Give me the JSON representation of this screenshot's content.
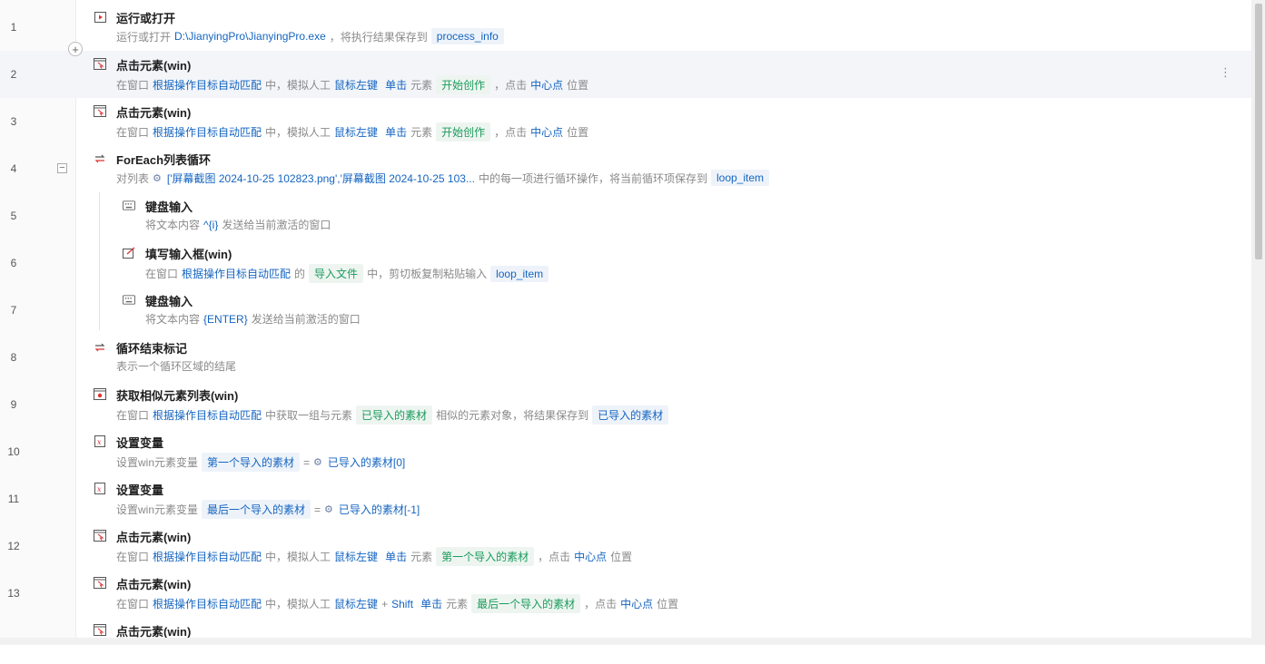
{
  "rows": [
    {
      "line": "1",
      "title": "运行或打开",
      "icon": "play-icon",
      "desc": [
        {
          "k": "t",
          "s": "运行或打开"
        },
        {
          "k": "v",
          "s": "D:\\JianyingPro\\JianyingPro.exe"
        },
        {
          "k": "t",
          "s": "，将执行结果保存到"
        },
        {
          "k": "tag",
          "s": "process_info"
        }
      ]
    },
    {
      "line": "2",
      "title": "点击元素(win)",
      "icon": "click-element-icon",
      "desc": [
        {
          "k": "t",
          "s": "在窗口"
        },
        {
          "k": "v",
          "s": "根据操作目标自动匹配"
        },
        {
          "k": "t",
          "s": "中，模拟人工"
        },
        {
          "k": "v",
          "s": "鼠标左键"
        },
        {
          "k": "v",
          "s": "单击"
        },
        {
          "k": "t",
          "s": "元素"
        },
        {
          "k": "tagg",
          "s": "开始创作"
        },
        {
          "k": "t",
          "s": "，点击"
        },
        {
          "k": "v",
          "s": "中心点"
        },
        {
          "k": "t",
          "s": "位置"
        }
      ]
    },
    {
      "line": "3",
      "title": "点击元素(win)",
      "icon": "click-element-icon",
      "desc": [
        {
          "k": "t",
          "s": "在窗口"
        },
        {
          "k": "v",
          "s": "根据操作目标自动匹配"
        },
        {
          "k": "t",
          "s": "中，模拟人工"
        },
        {
          "k": "v",
          "s": "鼠标左键"
        },
        {
          "k": "v",
          "s": "单击"
        },
        {
          "k": "t",
          "s": "元素"
        },
        {
          "k": "tagg",
          "s": "开始创作"
        },
        {
          "k": "t",
          "s": "，点击"
        },
        {
          "k": "v",
          "s": "中心点"
        },
        {
          "k": "t",
          "s": "位置"
        }
      ]
    },
    {
      "line": "4",
      "title": "ForEach列表循环",
      "icon": "loop-icon",
      "desc": [
        {
          "k": "t",
          "s": "对列表"
        },
        {
          "k": "sym",
          "s": "⚙"
        },
        {
          "k": "v",
          "s": "['屏幕截图 2024-10-25 102823.png','屏幕截图 2024-10-25 103..."
        },
        {
          "k": "t",
          "s": "中的每一项进行循环操作，将当前循环项保存到"
        },
        {
          "k": "tag",
          "s": "loop_item"
        }
      ]
    },
    {
      "line": "5",
      "title": "键盘输入",
      "icon": "keyboard-icon",
      "indent": true,
      "desc": [
        {
          "k": "t",
          "s": "将文本内容"
        },
        {
          "k": "v",
          "s": "^{i}"
        },
        {
          "k": "t",
          "s": "发送给当前激活的窗口"
        }
      ]
    },
    {
      "line": "6",
      "title": "填写输入框(win)",
      "icon": "input-box-icon",
      "indent": true,
      "desc": [
        {
          "k": "t",
          "s": "在窗口"
        },
        {
          "k": "v",
          "s": "根据操作目标自动匹配"
        },
        {
          "k": "t",
          "s": "的"
        },
        {
          "k": "tagg",
          "s": "导入文件"
        },
        {
          "k": "t",
          "s": "中，剪切板复制粘贴输入"
        },
        {
          "k": "tag",
          "s": "loop_item"
        }
      ]
    },
    {
      "line": "7",
      "title": "键盘输入",
      "icon": "keyboard-icon",
      "indent": true,
      "desc": [
        {
          "k": "t",
          "s": "将文本内容"
        },
        {
          "k": "v",
          "s": "{ENTER}"
        },
        {
          "k": "t",
          "s": "发送给当前激活的窗口"
        }
      ]
    },
    {
      "line": "8",
      "title": "循环结束标记",
      "icon": "loop-end-icon",
      "desc": [
        {
          "k": "t",
          "s": "表示一个循环区域的结尾"
        }
      ]
    },
    {
      "line": "9",
      "title": "获取相似元素列表(win)",
      "icon": "similar-elements-icon",
      "desc": [
        {
          "k": "t",
          "s": "在窗口"
        },
        {
          "k": "v",
          "s": "根据操作目标自动匹配"
        },
        {
          "k": "t",
          "s": "中获取一组与元素"
        },
        {
          "k": "tagg",
          "s": "已导入的素材"
        },
        {
          "k": "t",
          "s": "相似的元素对象，将结果保存到"
        },
        {
          "k": "tag",
          "s": "已导入的素材"
        }
      ]
    },
    {
      "line": "10",
      "title": "设置变量",
      "icon": "variable-icon",
      "desc": [
        {
          "k": "t",
          "s": "设置win元素变量"
        },
        {
          "k": "tag",
          "s": "第一个导入的素材"
        },
        {
          "k": "t",
          "s": "="
        },
        {
          "k": "sym",
          "s": "⚙"
        },
        {
          "k": "v",
          "s": "已导入的素材[0]"
        }
      ]
    },
    {
      "line": "11",
      "title": "设置变量",
      "icon": "variable-icon",
      "desc": [
        {
          "k": "t",
          "s": "设置win元素变量"
        },
        {
          "k": "tag",
          "s": "最后一个导入的素材"
        },
        {
          "k": "t",
          "s": "="
        },
        {
          "k": "sym",
          "s": "⚙"
        },
        {
          "k": "v",
          "s": "已导入的素材[-1]"
        }
      ]
    },
    {
      "line": "12",
      "title": "点击元素(win)",
      "icon": "click-element-icon",
      "desc": [
        {
          "k": "t",
          "s": "在窗口"
        },
        {
          "k": "v",
          "s": "根据操作目标自动匹配"
        },
        {
          "k": "t",
          "s": "中，模拟人工"
        },
        {
          "k": "v",
          "s": "鼠标左键"
        },
        {
          "k": "v",
          "s": "单击"
        },
        {
          "k": "t",
          "s": "元素"
        },
        {
          "k": "tagg",
          "s": "第一个导入的素材"
        },
        {
          "k": "t",
          "s": "，点击"
        },
        {
          "k": "v",
          "s": "中心点"
        },
        {
          "k": "t",
          "s": "位置"
        }
      ]
    },
    {
      "line": "13",
      "title": "点击元素(win)",
      "icon": "click-element-icon",
      "desc": [
        {
          "k": "t",
          "s": "在窗口"
        },
        {
          "k": "v",
          "s": "根据操作目标自动匹配"
        },
        {
          "k": "t",
          "s": "中，模拟人工"
        },
        {
          "k": "v",
          "s": "鼠标左键"
        },
        {
          "k": "t",
          "s": "+"
        },
        {
          "k": "v",
          "s": "Shift"
        },
        {
          "k": "v",
          "s": "单击"
        },
        {
          "k": "t",
          "s": "元素"
        },
        {
          "k": "tagg",
          "s": "最后一个导入的素材"
        },
        {
          "k": "t",
          "s": "，点击"
        },
        {
          "k": "v",
          "s": "中心点"
        },
        {
          "k": "t",
          "s": "位置"
        }
      ]
    },
    {
      "line": "",
      "title": "点击元素(win)",
      "icon": "click-element-icon",
      "desc": []
    }
  ],
  "controls": {
    "add_step": "+",
    "collapse": "−",
    "more": "⋮"
  },
  "colors": {
    "value": "#1565c0",
    "green": "#1a9b5b",
    "tag_bg": "#eef3fa",
    "highlight_row": "#f3f5f9"
  }
}
